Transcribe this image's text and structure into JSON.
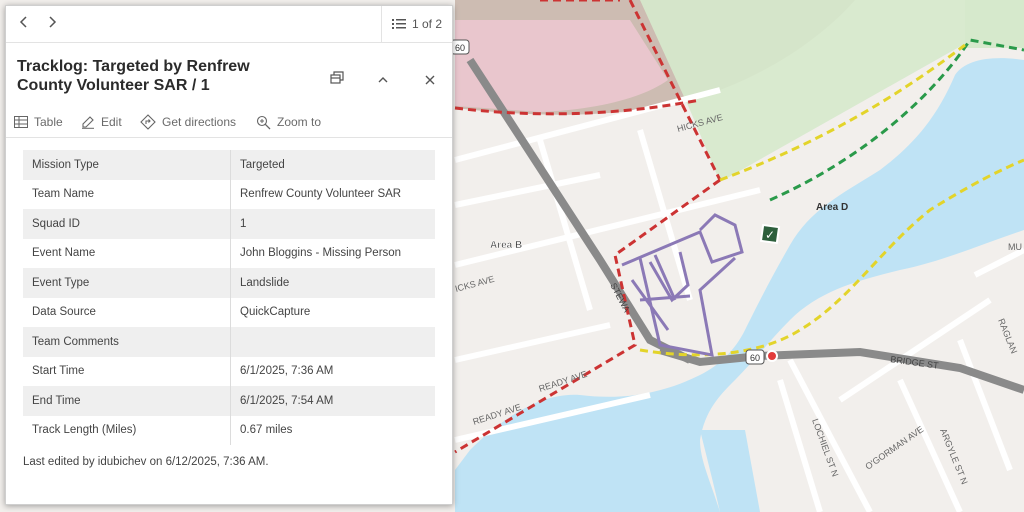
{
  "map": {
    "labels": {
      "area_b": "Area B",
      "area_d": "Area D",
      "hicks_ave_a": "HICKS AVE",
      "hicks_ave_b": "ICKS AVE",
      "ready_ave_a": "READY AVE",
      "ready_ave_b": "READY AVE",
      "bridge_st": "BRIDGE ST",
      "stewart_st": "STEWA",
      "lochiel_st": "LOCHIEL ST N",
      "ogorman_ave": "O'GORMAN AVE",
      "argyle_st": "ARGYLE ST N",
      "raglan_st": "RAGLAN",
      "mu_st": "MU",
      "route_60_a": "60",
      "route_60_b": "60"
    }
  },
  "popup": {
    "pager": {
      "label": "1 of 2"
    },
    "title": "Tracklog: Targeted by Renfrew County Volunteer SAR / 1",
    "actions": {
      "table": "Table",
      "edit": "Edit",
      "directions": "Get directions",
      "zoom": "Zoom to"
    },
    "fields": [
      {
        "key": "Mission Type",
        "value": "Targeted"
      },
      {
        "key": "Team Name",
        "value": "Renfrew County Volunteer SAR"
      },
      {
        "key": "Squad ID",
        "value": "1"
      },
      {
        "key": "Event Name",
        "value": "John Bloggins - Missing Person"
      },
      {
        "key": "Event Type",
        "value": "Landslide"
      },
      {
        "key": "Data Source",
        "value": "QuickCapture"
      },
      {
        "key": "Team Comments",
        "value": ""
      },
      {
        "key": "Start Time",
        "value": "6/1/2025, 7:36 AM"
      },
      {
        "key": "End Time",
        "value": "6/1/2025, 7:54 AM"
      },
      {
        "key": "Track Length (Miles)",
        "value": "0.67 miles"
      }
    ],
    "footer": "Last edited by idubichev on 6/12/2025, 7:36 AM."
  },
  "colors": {
    "water": "#bfe3f5",
    "park": "#d6e9cc",
    "brown_zone": "#c7b3a8",
    "pink_zone": "#ecc6cf",
    "track": "#8b79b6",
    "road_major": "#8a8a8a"
  }
}
